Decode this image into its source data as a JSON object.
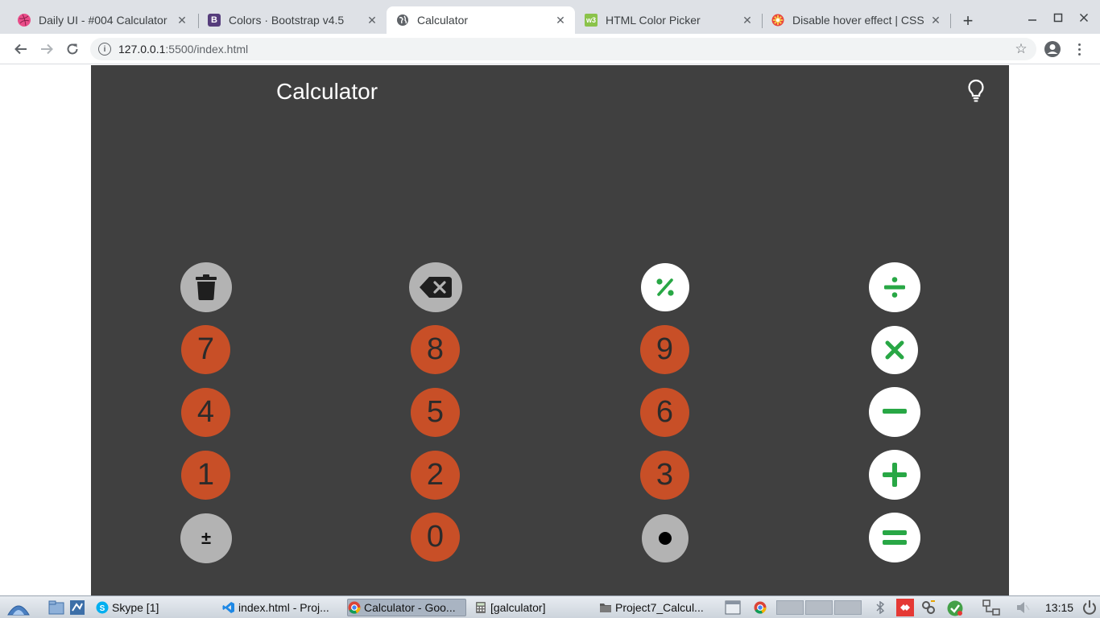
{
  "browser": {
    "tabs": [
      {
        "title": "Daily UI - #004 Calculator",
        "favicon": "dribbble-icon",
        "favicon_color": "#ea4c89",
        "active": false
      },
      {
        "title": "Colors · Bootstrap v4.5",
        "favicon": "bootstrap-icon",
        "favicon_color": "#563d7c",
        "active": false
      },
      {
        "title": "Calculator",
        "favicon": "globe-icon",
        "favicon_color": "#5f6368",
        "active": true
      },
      {
        "title": "HTML Color Picker",
        "favicon": "w3schools-icon",
        "favicon_color": "#8bc34a",
        "active": false
      },
      {
        "title": "Disable hover effect | CSS",
        "favicon": "codepen-icon",
        "favicon_color": "#e9473f",
        "active": false
      }
    ],
    "url_host": "127.0.0.1",
    "url_path": ":5500/index.html"
  },
  "app": {
    "title": "Calculator",
    "background": "#404040",
    "number_color": "#c84f27",
    "function_color": "#b3b3b3",
    "operator_color": "#ffffff",
    "operator_icon_color": "#28a745",
    "keys": {
      "clear": "trash-icon",
      "backspace": "backspace-icon",
      "percent": "percent-icon",
      "divide": "divide-icon",
      "n7": "7",
      "n8": "8",
      "n9": "9",
      "multiply": "times-icon",
      "n4": "4",
      "n5": "5",
      "n6": "6",
      "subtract": "minus-icon",
      "n1": "1",
      "n2": "2",
      "n3": "3",
      "add": "plus-icon",
      "sign": "±",
      "n0": "0",
      "decimal": "dot-icon",
      "equals": "equals-icon"
    }
  },
  "taskbar": {
    "items": [
      {
        "label": "Skype [1]",
        "icon": "skype-icon"
      },
      {
        "label": "index.html - Proj...",
        "icon": "vscode-icon"
      },
      {
        "label": "Calculator - Goo...",
        "icon": "chrome-icon",
        "active": true
      },
      {
        "label": "[galculator]",
        "icon": "calculator-app-icon"
      },
      {
        "label": "Project7_Calcul...",
        "icon": "folder-icon"
      }
    ],
    "clock": "13:15"
  }
}
